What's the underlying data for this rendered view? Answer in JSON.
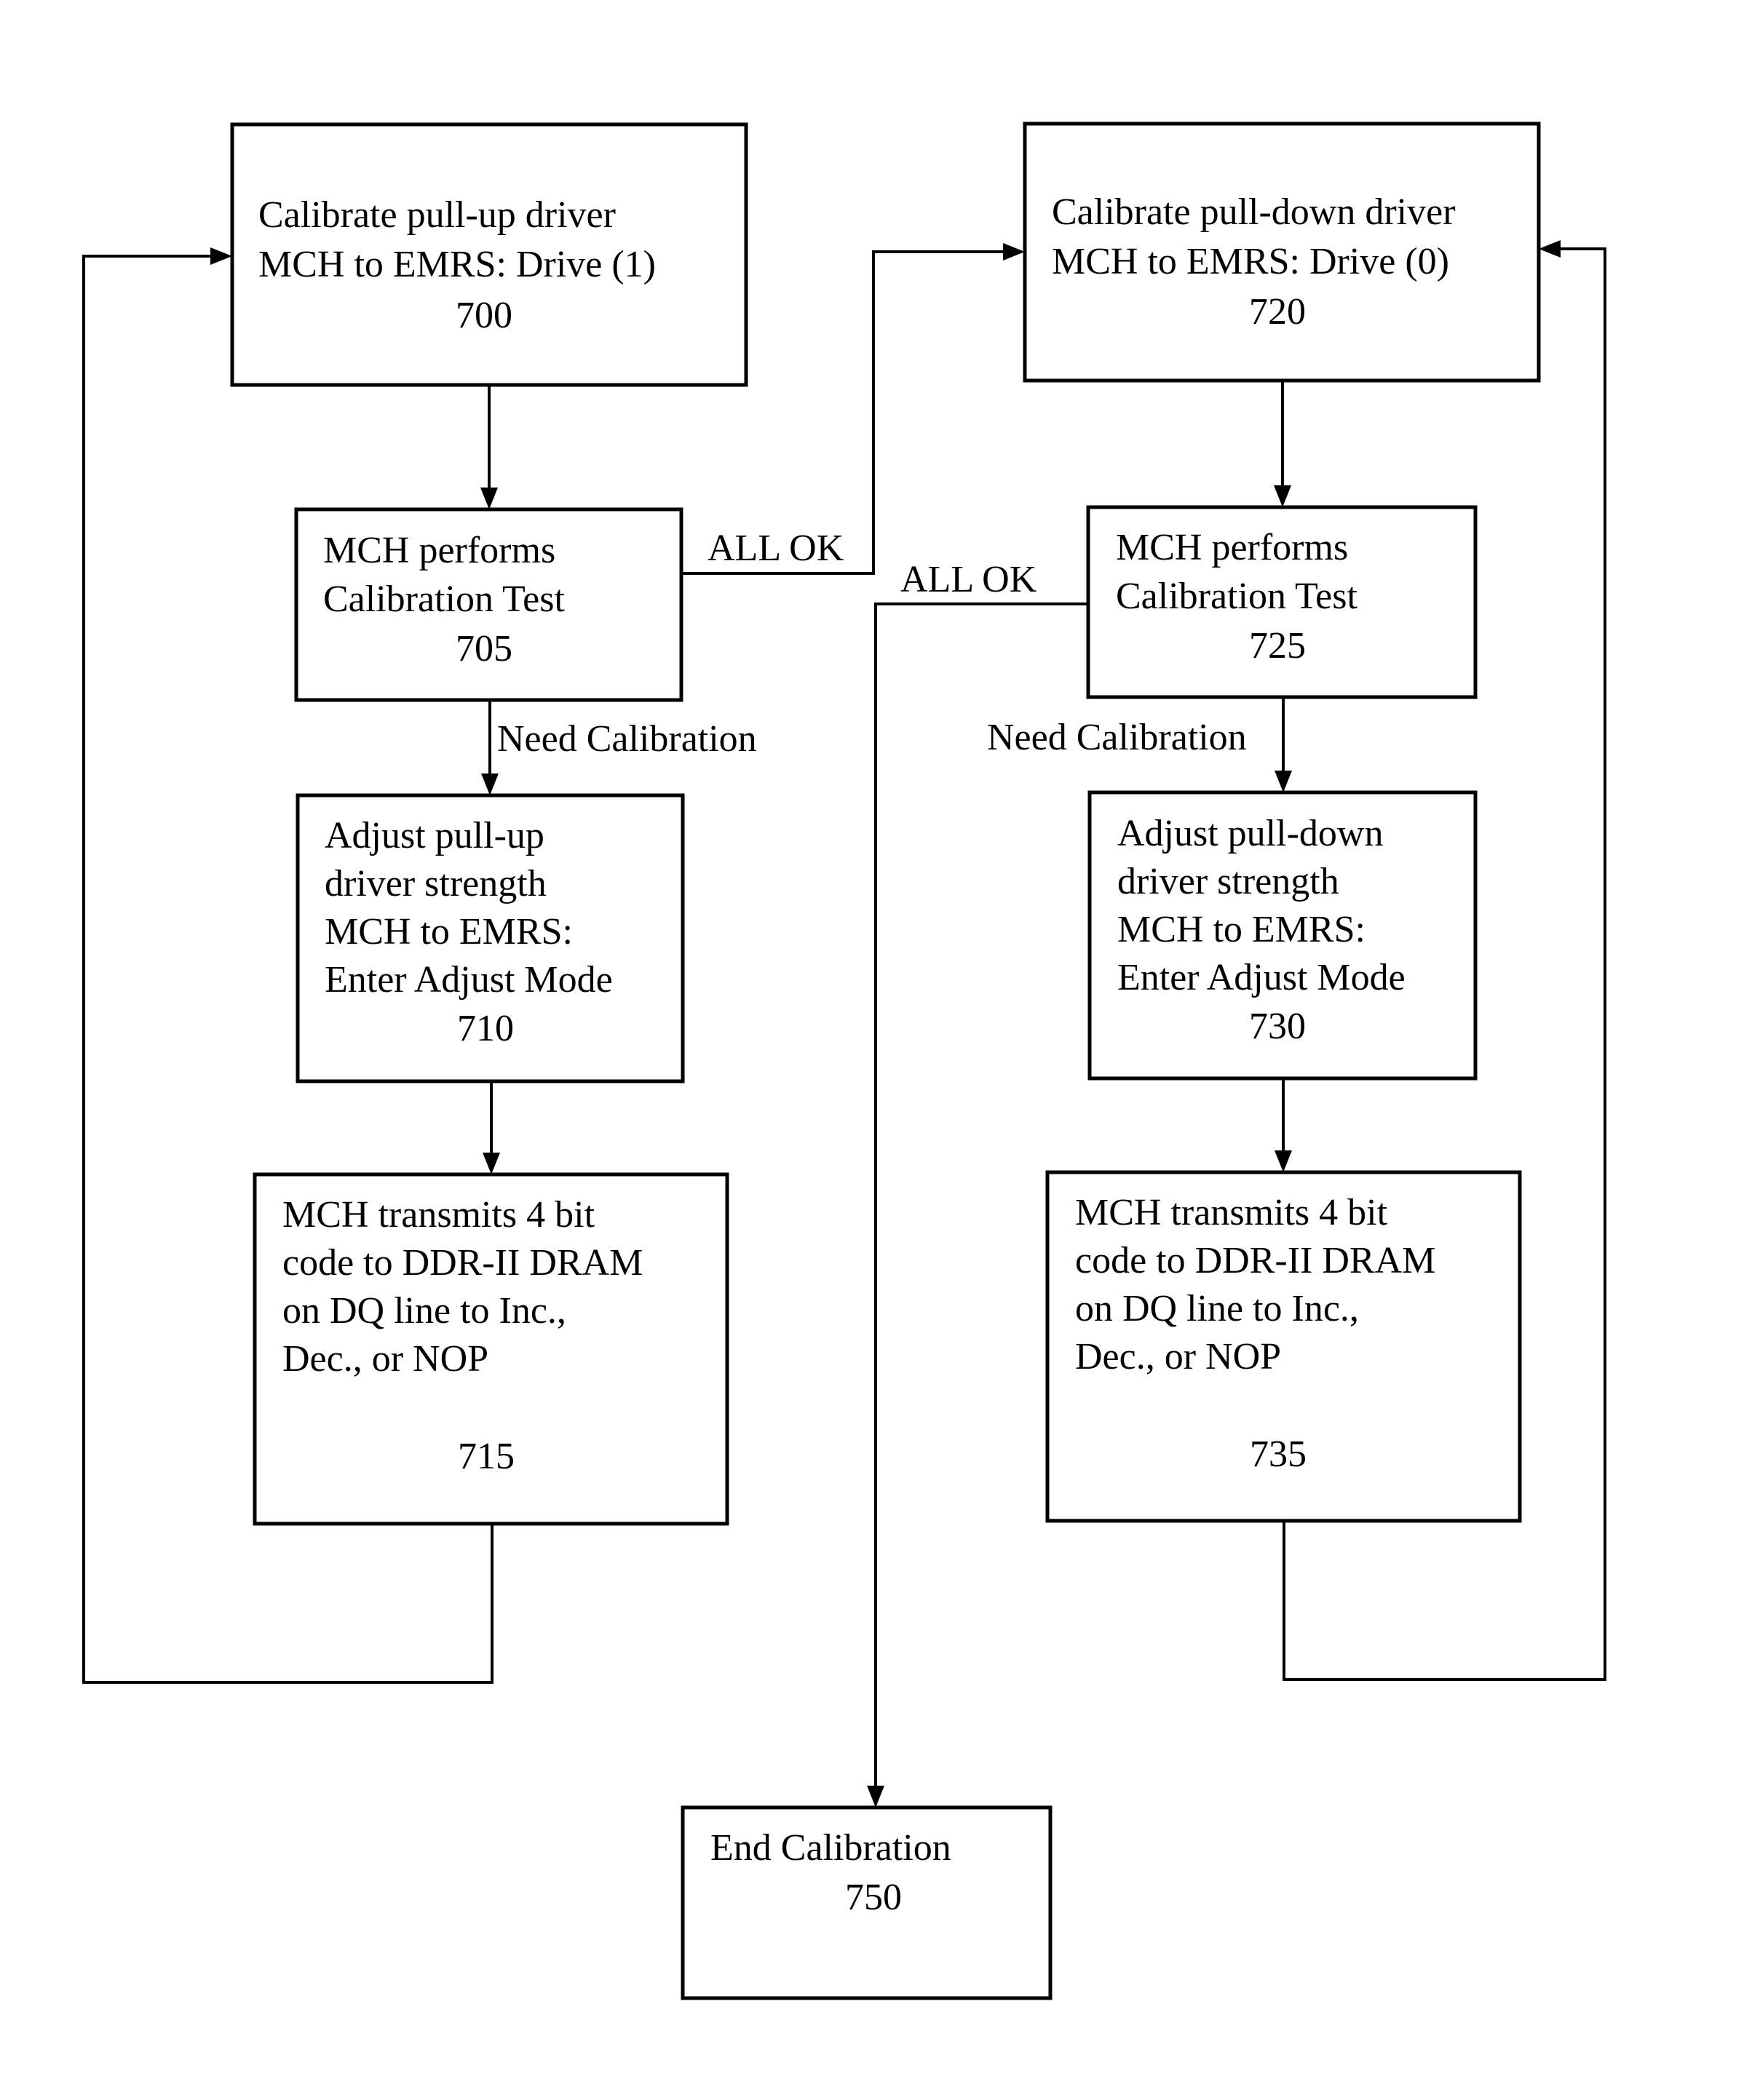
{
  "figure": {
    "nodes": [
      {
        "id": "700",
        "lines": [
          "Calibrate pull-up driver",
          "MCH to EMRS: Drive (1)"
        ],
        "ref": "700"
      },
      {
        "id": "705",
        "lines": [
          "MCH performs",
          "Calibration Test"
        ],
        "ref": "705"
      },
      {
        "id": "710",
        "lines": [
          "Adjust pull-up",
          "driver strength",
          "MCH to EMRS:",
          "Enter Adjust Mode"
        ],
        "ref": "710"
      },
      {
        "id": "715",
        "lines": [
          "MCH transmits 4 bit",
          "code to DDR-II DRAM",
          "on DQ line to Inc.,",
          "Dec., or NOP"
        ],
        "ref": "715"
      },
      {
        "id": "720",
        "lines": [
          "Calibrate pull-down driver",
          "MCH to EMRS: Drive (0)"
        ],
        "ref": "720"
      },
      {
        "id": "725",
        "lines": [
          "MCH performs",
          "Calibration Test"
        ],
        "ref": "725"
      },
      {
        "id": "730",
        "lines": [
          "Adjust pull-down",
          "driver strength",
          "MCH to EMRS:",
          "Enter Adjust Mode"
        ],
        "ref": "730"
      },
      {
        "id": "735",
        "lines": [
          "MCH transmits 4 bit",
          "code to DDR-II DRAM",
          "on DQ line to Inc.,",
          "Dec., or NOP"
        ],
        "ref": "735"
      },
      {
        "id": "750",
        "lines": [
          "End Calibration"
        ],
        "ref": "750"
      }
    ],
    "edge_labels": {
      "all_ok_left": "ALL OK",
      "all_ok_right": "ALL OK",
      "need_cal_left": "Need Calibration",
      "need_cal_right": "Need Calibration"
    }
  }
}
